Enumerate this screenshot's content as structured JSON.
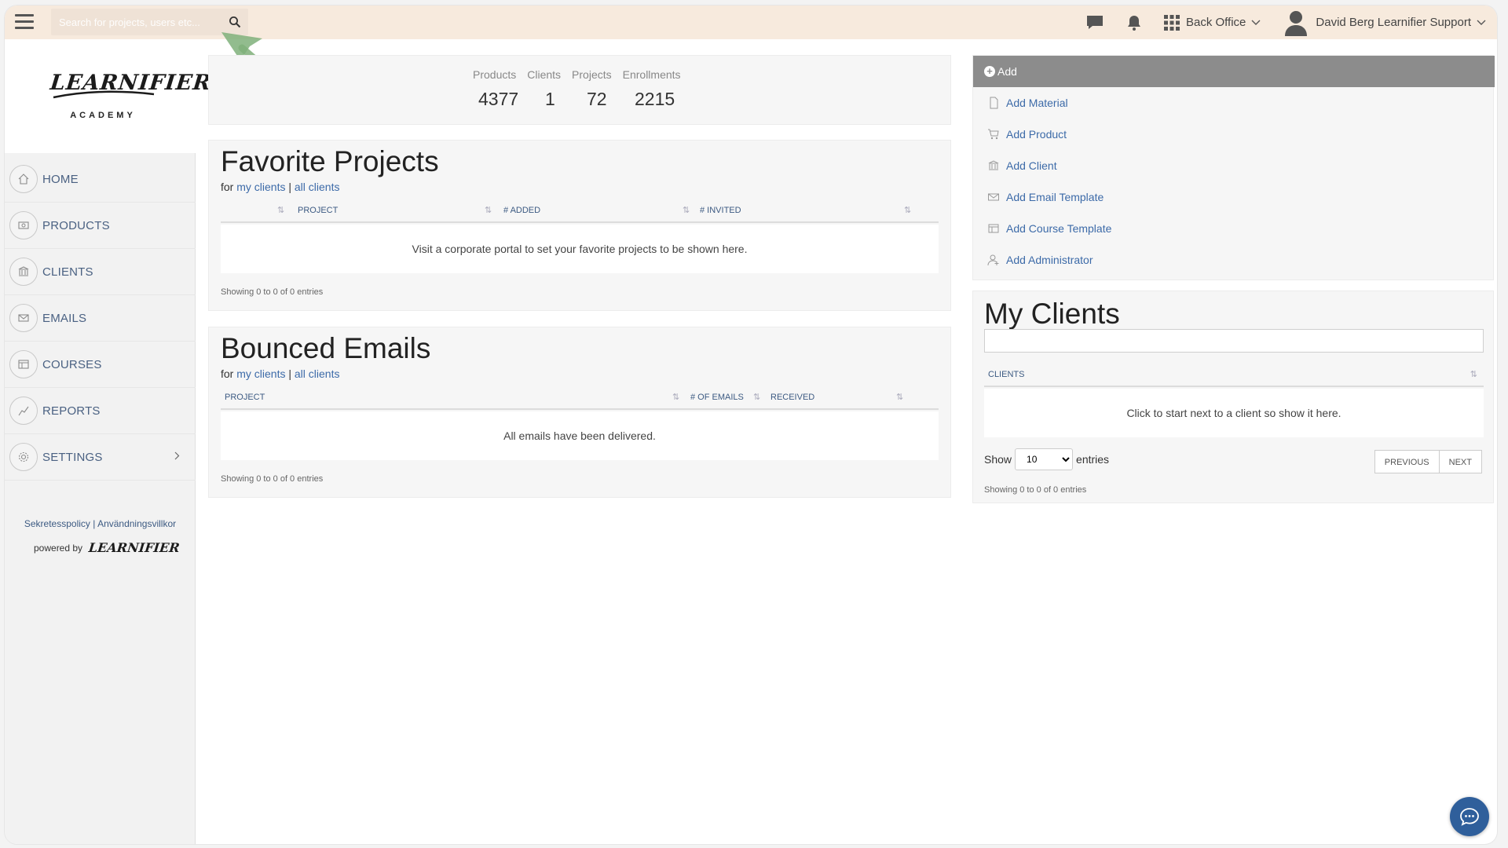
{
  "topbar": {
    "search_placeholder": "Search for projects, users etc...",
    "backoffice_label": "Back Office",
    "user_name": "David Berg Learnifier Support",
    "accent": "#f7eadd"
  },
  "sidebar": {
    "logo_main": "LEARNIFIER",
    "logo_sub": "ACADEMY",
    "items": [
      {
        "label": "HOME",
        "icon": "home-icon"
      },
      {
        "label": "PRODUCTS",
        "icon": "products-icon"
      },
      {
        "label": "CLIENTS",
        "icon": "bank-icon"
      },
      {
        "label": "EMAILS",
        "icon": "envelope-icon"
      },
      {
        "label": "COURSES",
        "icon": "course-icon"
      },
      {
        "label": "REPORTS",
        "icon": "chart-line-icon"
      },
      {
        "label": "SETTINGS",
        "icon": "gear-icon"
      }
    ],
    "footer_privacy": "Sekretesspolicy",
    "footer_sep": "|",
    "footer_terms": "Användningsvillkor",
    "powered_by": "powered by",
    "powered_logo": "LEARNIFIER"
  },
  "stats": {
    "labels": [
      "Products",
      "Clients",
      "Projects",
      "Enrollments"
    ],
    "values": [
      "4377",
      "1",
      "72",
      "2215"
    ]
  },
  "favorite_projects": {
    "title": "Favorite Projects",
    "for_prefix": "for",
    "my_clients": "my clients",
    "sep": "|",
    "all_clients": "all clients",
    "columns": [
      "PROJECT",
      "# ADDED",
      "# INVITED"
    ],
    "empty_message": "Visit a corporate portal to set your favorite projects to be shown here.",
    "showing": "Showing 0 to 0 of 0 entries"
  },
  "bounced_emails": {
    "title": "Bounced Emails",
    "for_prefix": "for",
    "my_clients": "my clients",
    "sep": "|",
    "all_clients": "all clients",
    "columns": [
      "PROJECT",
      "# OF EMAILS",
      "RECEIVED"
    ],
    "empty_message": "All emails have been delivered.",
    "showing": "Showing 0 to 0 of 0 entries"
  },
  "add_panel": {
    "title": "Add",
    "items": [
      {
        "label": "Add Material",
        "icon": "file-icon"
      },
      {
        "label": "Add Product",
        "icon": "cart-icon"
      },
      {
        "label": "Add Client",
        "icon": "bank-icon"
      },
      {
        "label": "Add Email Template",
        "icon": "envelope-icon"
      },
      {
        "label": "Add Course Template",
        "icon": "course-icon"
      },
      {
        "label": "Add Administrator",
        "icon": "add-user-icon"
      }
    ]
  },
  "my_clients": {
    "title": "My Clients",
    "column": "CLIENTS",
    "empty_message": "Click to start next to a client so show it here.",
    "show_label": "Show",
    "show_value": "10",
    "entries_label": "entries",
    "previous": "PREVIOUS",
    "next": "NEXT",
    "showing": "Showing 0 to 0 of 0 entries"
  }
}
